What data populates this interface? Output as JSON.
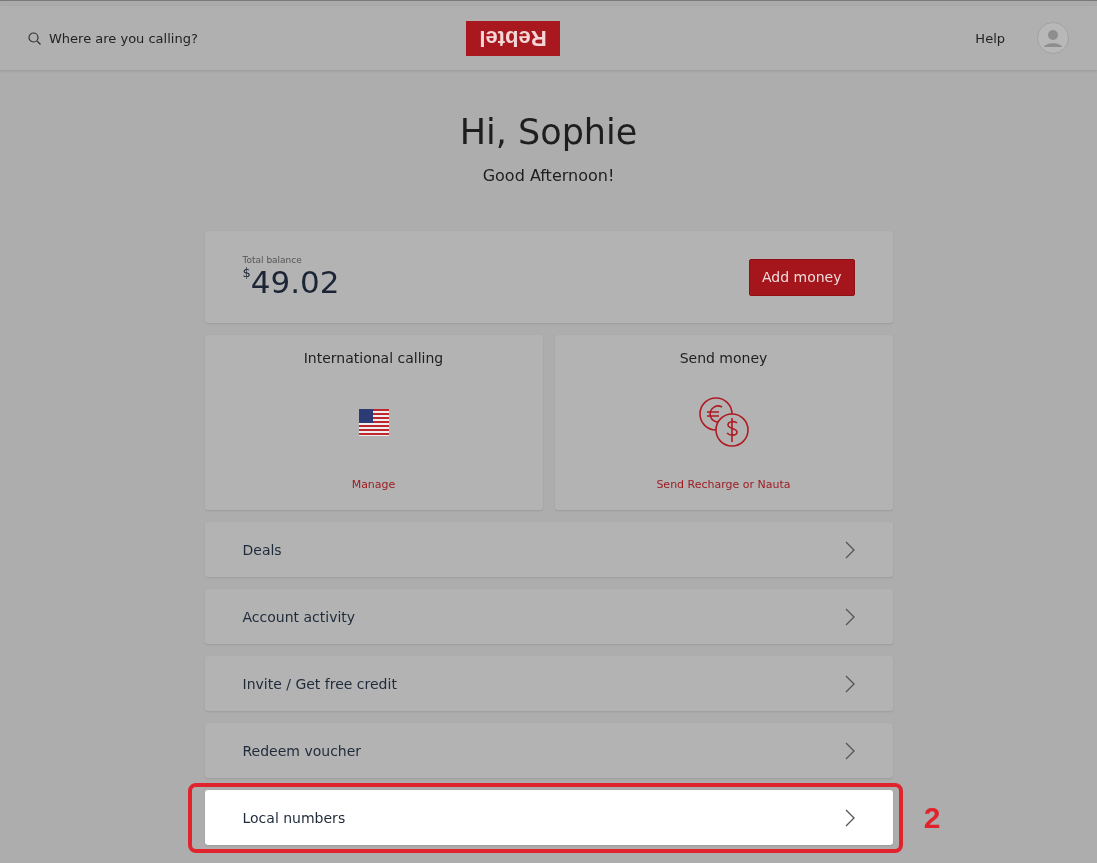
{
  "header": {
    "search": {
      "placeholder": "Where are you calling?"
    },
    "logo": "Rebtel",
    "help": "Help"
  },
  "greeting": {
    "title": "Hi, Sophie",
    "subtitle": "Good Afternoon!"
  },
  "balance": {
    "label": "Total balance",
    "currency": "$",
    "amount": "49.02",
    "button": "Add money"
  },
  "tiles": [
    {
      "kind": "flag",
      "title": "International calling",
      "link": "Manage"
    },
    {
      "kind": "coins",
      "title": "Send money",
      "link": "Send Recharge or Nauta"
    }
  ],
  "rows": [
    {
      "label": "Deals",
      "highlighted": false
    },
    {
      "label": "Account activity",
      "highlighted": false
    },
    {
      "label": "Invite / Get free credit",
      "highlighted": false
    },
    {
      "label": "Redeem voucher",
      "highlighted": false
    },
    {
      "label": "Local numbers",
      "highlighted": true,
      "annotation": "2"
    }
  ]
}
